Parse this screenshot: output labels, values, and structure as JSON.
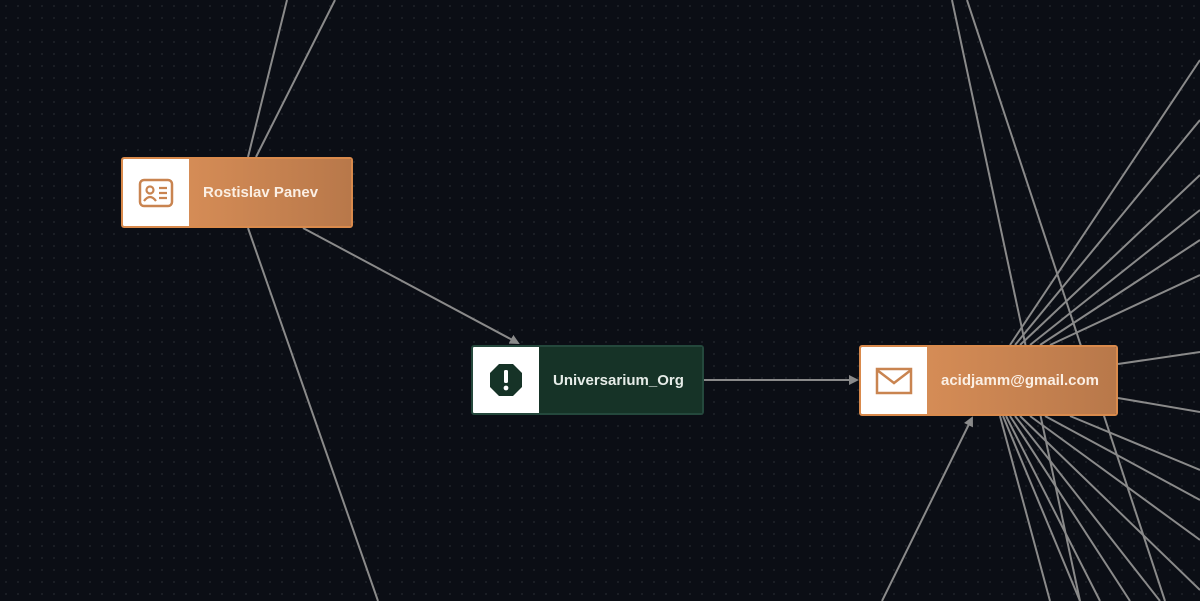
{
  "graph": {
    "nodes": [
      {
        "id": "person",
        "label": "Rostislav Panev",
        "icon": "contact-card-icon",
        "kind": "person"
      },
      {
        "id": "org",
        "label": "Universarium_Org",
        "icon": "alert-octagon-icon",
        "kind": "organization"
      },
      {
        "id": "email",
        "label": "acidjamm@gmail.com",
        "icon": "envelope-icon",
        "kind": "email"
      }
    ],
    "edges": [
      {
        "from": "person",
        "to": "org",
        "directed": true
      },
      {
        "from": "org",
        "to": "email",
        "directed": true
      }
    ]
  },
  "colors": {
    "background": "#0b0e15",
    "edge": "#8a8a8a",
    "orange_node": "#c98450",
    "green_node": "#163327",
    "icon_orange": "#c98450",
    "icon_green": "#163327"
  }
}
